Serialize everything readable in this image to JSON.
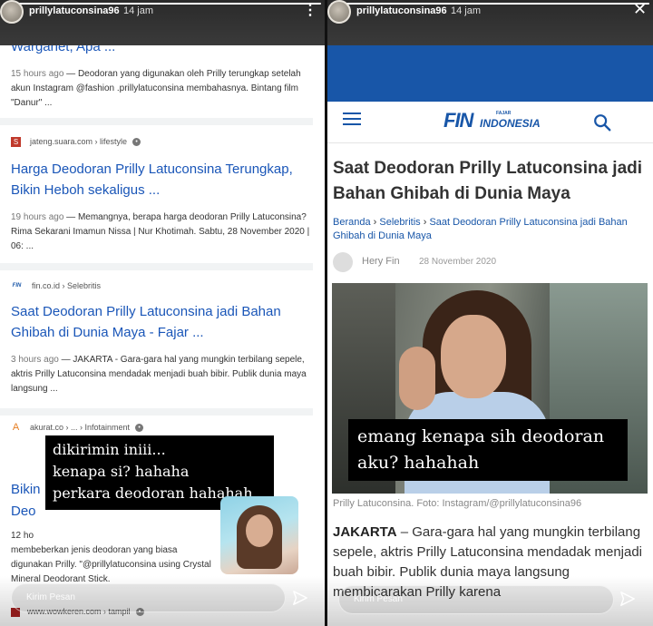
{
  "left_story": {
    "username": "prillylatuconsina96",
    "time": "14 jam",
    "progress": 1.0,
    "results": [
      {
        "title": "Warganet, Apa ...",
        "date": "15 hours ago",
        "snippet": "— Deodoran yang digunakan oleh Prilly terungkap setelah akun Instagram @fashion .prillylatuconsina membahasnya. Bintang film \"Danur\" ..."
      },
      {
        "favicon": "S",
        "source": "jateng.suara.com › lifestyle",
        "title": "Harga Deodoran Prilly Latuconsina Terungkap, Bikin Heboh sekaligus ...",
        "date": "19 hours ago",
        "snippet": "— Memangnya, berapa harga deodoran Prilly Latuconsina? Rima Sekarani Imamun Nissa | Nur Khotimah. Sabtu, 28 November 2020 | 06: ..."
      },
      {
        "favicon": "FIN",
        "source": "fin.co.id › Selebritis",
        "title": "Saat Deodoran Prilly Latuconsina jadi Bahan Ghibah di Dunia Maya - Fajar ...",
        "date": "3 hours ago",
        "snippet": "— JAKARTA - Gara-gara hal yang mungkin terbilang sepele, aktris Prilly Latuconsina mendadak menjadi buah bibir. Publik dunia maya langsung ..."
      },
      {
        "favicon": "A",
        "source": "akurat.co › ... › Infotainment",
        "title_visible_1": "Bikin",
        "title_visible_2": "Deo",
        "date_visible": "12 ho",
        "snippet": "membeberkan jenis deodoran yang biasa digunakan Prilly. \"@prillylatuconsina using Crystal Mineral Deodorant Stick."
      }
    ],
    "caption_lines": [
      "dikirimin iniii...",
      "kenapa si? hahaha",
      "perkara deodoran hahahah"
    ],
    "message_placeholder": "Kirim Pesan",
    "bottom_link": "www.wowkeren.com › tampil"
  },
  "right_story": {
    "username": "prillylatuconsina96",
    "time": "14 jam",
    "progress": 1.0,
    "site": {
      "logo": "FIN",
      "logo_top": "FAJAR",
      "logo_sub": "INDONESIA"
    },
    "article": {
      "title": "Saat Deodoran Prilly Latuconsina jadi Bahan Ghibah di Dunia Maya",
      "breadcrumb_1": "Beranda",
      "breadcrumb_2": "Selebritis",
      "breadcrumb_3": "Saat Deodoran Prilly Latuconsina jadi Bahan Ghibah di Dunia Maya",
      "author": "Hery Fin",
      "date": "28 November 2020",
      "photo_caption": "Prilly Latuconsina. Foto: Instagram/@prillylatuconsina96",
      "body_lead": "JAKARTA",
      "body": " – Gara-gara hal yang mungkin terbilang sepele, aktris Prilly Latuconsina mendadak menjadi buah bibir. Publik dunia maya langsung membicarakan Prilly karena"
    },
    "caption_lines": [
      "emang kenapa sih deodoran",
      "aku? hahahah"
    ],
    "message_placeholder": "Kirim Pesan"
  },
  "colors": {
    "link_blue": "#1a56b8",
    "fin_blue": "#1856a8",
    "story_header": "#2a2a2a"
  }
}
